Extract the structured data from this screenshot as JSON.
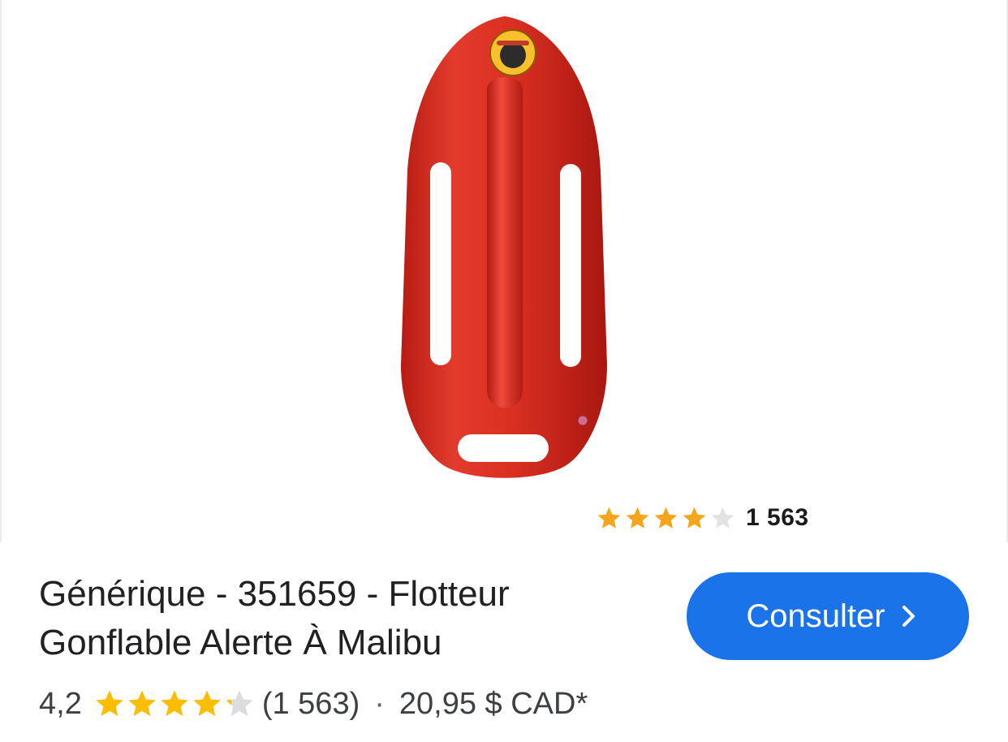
{
  "product": {
    "title": "Générique - 351659 - Flotteur Gonflable Alerte À Malibu",
    "image_alt": "inflatable-red-rescue-buoy",
    "image_rating": {
      "stars": 4,
      "max_stars": 5,
      "count": "1 563"
    },
    "rating_value": "4,2",
    "rating_stars": 4.2,
    "review_count": "(1 563)",
    "separator": "·",
    "price": "20,95 $ CAD*"
  },
  "actions": {
    "consult_label": "Consulter",
    "consult_icon": "chevron-right-icon"
  },
  "colors": {
    "accent": "#1a73e8",
    "star": "#fbbc04",
    "star_empty": "#dadce0",
    "buoy": "#d42a1e"
  }
}
